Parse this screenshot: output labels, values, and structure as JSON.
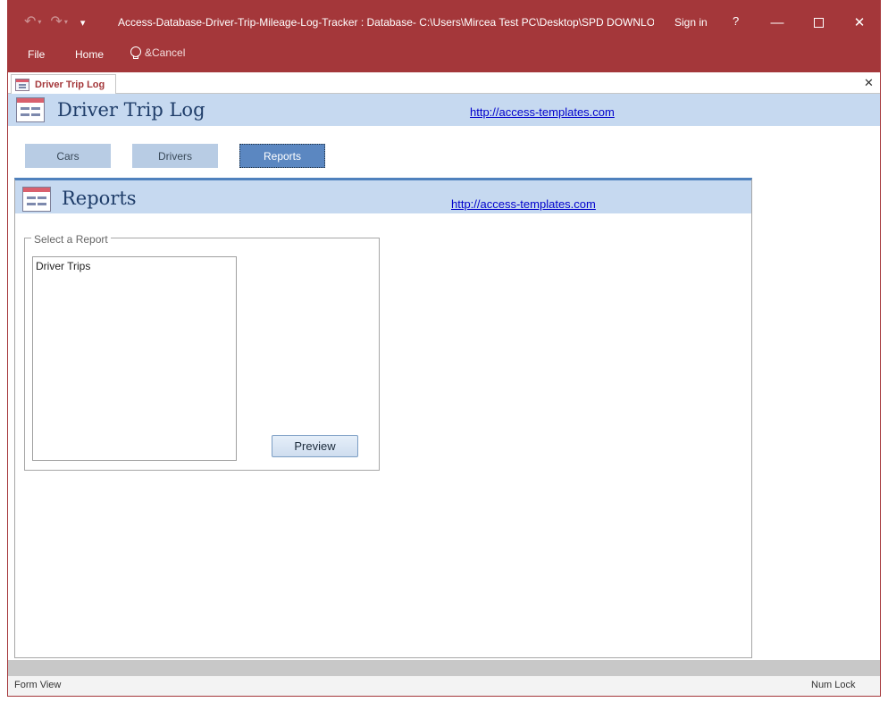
{
  "window": {
    "title": "Access-Database-Driver-Trip-Mileage-Log-Tracker : Database- C:\\Users\\Mircea Test PC\\Desktop\\SPD DOWNLO...",
    "sign_in": "Sign in",
    "help": "?",
    "minimize_glyph": "—",
    "close_glyph": "✕"
  },
  "quick_access": {
    "undo_glyph": "↶",
    "redo_glyph": "↷",
    "caret_glyph": "▾",
    "customize_glyph": "▾"
  },
  "ribbon": {
    "tabs": [
      {
        "label": "File"
      },
      {
        "label": "Home"
      }
    ],
    "tell_me": "&Cancel"
  },
  "document_tab": {
    "label": "Driver Trip Log",
    "close_glyph": "✕"
  },
  "main_form": {
    "title": "Driver Trip Log",
    "link": "http://access-templates.com"
  },
  "nav_buttons": [
    {
      "label": "Cars"
    },
    {
      "label": "Drivers"
    },
    {
      "label": "Reports",
      "selected": true
    }
  ],
  "subform": {
    "title": "Reports",
    "link": "http://access-templates.com",
    "group_label": "Select a Report",
    "reports": [
      {
        "label": "Driver Trips"
      }
    ],
    "preview_button": "Preview"
  },
  "status": {
    "left": "Form View",
    "right": "Num Lock"
  },
  "colors": {
    "accent": "#a4373a",
    "header_band": "#c6d9f0",
    "selected_nav": "#5b87c1",
    "nav_button": "#b8cce4",
    "link": "#0000cc"
  }
}
